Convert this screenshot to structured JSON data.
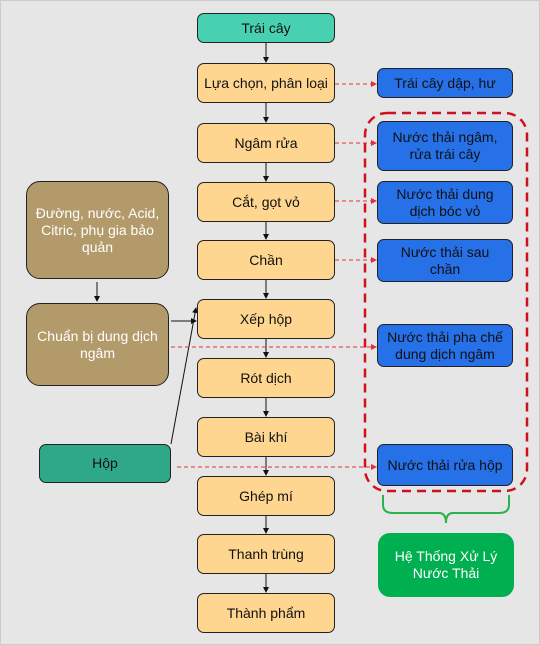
{
  "process": {
    "input": "Trái cây",
    "steps": [
      "Lựa chọn, phân loại",
      "Ngâm rửa",
      "Cắt, gọt vỏ",
      "Chần",
      "Xếp hộp",
      "Rót dịch",
      "Bài khí",
      "Ghép mí",
      "Thanh trùng",
      "Thành phẩm"
    ]
  },
  "waste": {
    "solid": "Trái cây dập, hư",
    "water": [
      "Nước thải ngâm, rửa trái cây",
      "Nước thải dung dịch bóc vỏ",
      "Nước thải sau chần",
      "Nước thải pha chế dung dịch ngâm",
      "Nước thải rửa hộp"
    ]
  },
  "side_inputs": {
    "ingredients": "Đường, nước, Acid, Citric, phụ gia bảo quản",
    "prepare": "Chuẩn bị dung dịch ngâm",
    "can": "Hộp"
  },
  "treatment": "Hệ Thống Xử Lý Nước Thải",
  "colors": {
    "input": "#48d1b0",
    "step": "#ffd68f",
    "waste": "#2670e8",
    "side": "#b39a6a",
    "can": "#2ea888",
    "treatment": "#00b050",
    "dashed": "#d0101e"
  }
}
